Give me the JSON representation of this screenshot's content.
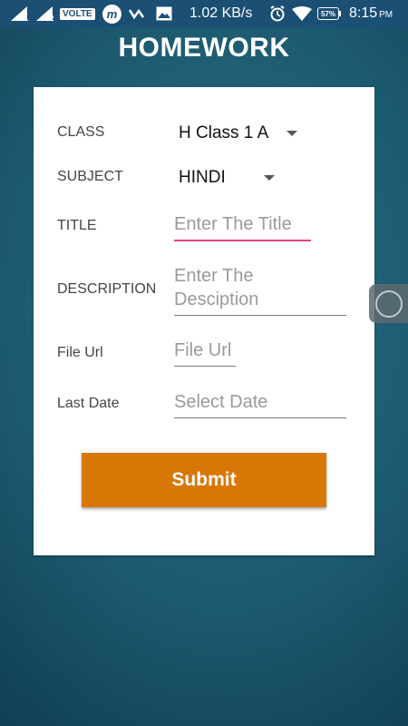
{
  "status_bar": {
    "sim1_label": "1",
    "sim2_label": "2",
    "volte": "VOLTE",
    "app_icon_letter": "m",
    "speed": "1.02 KB/s",
    "battery": "57%",
    "time": "8:15",
    "ampm": "PM",
    "bar_color": "#1b4f73"
  },
  "header": {
    "title": "HOMEWORK"
  },
  "form": {
    "class_label": "CLASS",
    "class_value": "H Class 1 A",
    "subject_label": "SUBJECT",
    "subject_value": "HINDI",
    "title_label": "TITLE",
    "title_placeholder": "Enter The Title",
    "description_label": "DESCRIPTION",
    "description_placeholder_line1": "Enter The",
    "description_placeholder_line2": "Desciption",
    "file_url_label": "File Url",
    "file_url_placeholder": "File Url",
    "last_date_label": "Last Date",
    "last_date_placeholder": "Select Date",
    "submit_label": "Submit",
    "accent_color": "#e0457b",
    "submit_color": "#d97706"
  },
  "icons": {
    "signal": "signal-icon",
    "app": "m-app-icon",
    "chevron": "chevron-check-icon",
    "image": "image-icon",
    "alarm": "alarm-icon",
    "wifi": "wifi-icon",
    "battery": "battery-icon",
    "dropdown": "caret-down-icon",
    "assistive": "assistive-touch-icon"
  }
}
